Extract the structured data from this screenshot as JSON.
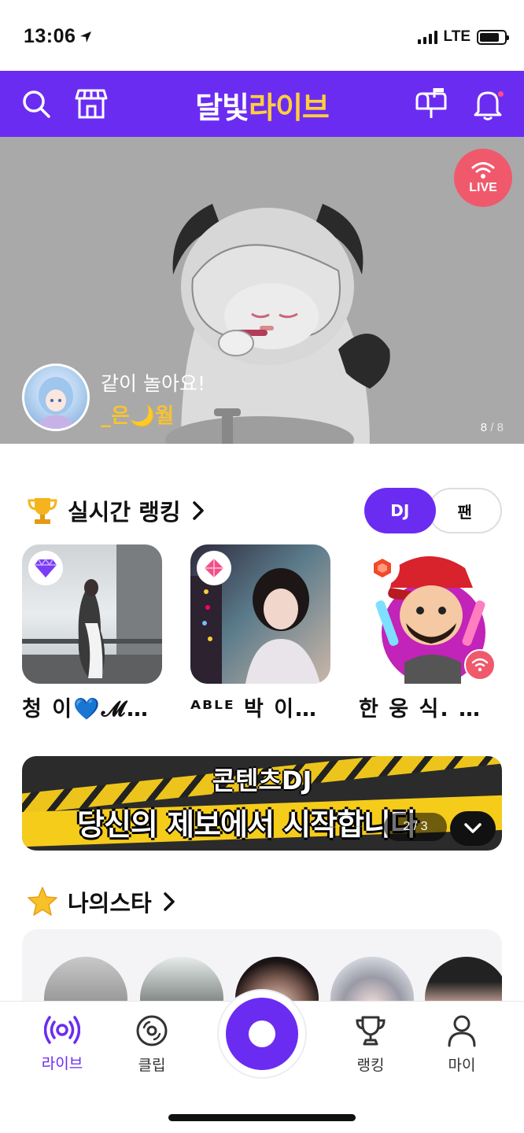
{
  "status_bar": {
    "time": "13:06",
    "network": "LTE",
    "battery_level": 0.8
  },
  "header": {
    "logo_part1": "달빛",
    "logo_part2": "라이브",
    "icons": [
      "search-icon",
      "store-icon",
      "mailbox-icon",
      "bell-icon"
    ],
    "colors": {
      "brand": "#6b2cf2",
      "logo_accent": "#ffcf3a"
    }
  },
  "banner": {
    "live_badge": "LIVE",
    "title": "같이 놀아요!",
    "username": "_은🌙월",
    "counter_current": "8",
    "counter_separator": "/",
    "counter_total": "8"
  },
  "ranking": {
    "title": "실시간 랭킹",
    "tabs": [
      "DJ",
      "팬"
    ],
    "selected_tab": "DJ",
    "items": [
      {
        "name": "청 이💙𝓜…",
        "badge": "diamond-purple-icon",
        "live": false
      },
      {
        "name": "ᴬᴮᴸᴱ 박 이…",
        "badge": "diamond-pink-icon",
        "live": false
      },
      {
        "name": "한 웅 식.  …",
        "badge": "gem-red-icon",
        "live": true
      }
    ]
  },
  "promo": {
    "line1": "콘텐츠DJ",
    "line2": "당신의 제보에서 시작합니다",
    "pager": "2 / 3"
  },
  "my_star": {
    "title": "나의스타",
    "avatar_count": 5
  },
  "bottom_nav": {
    "items": [
      {
        "label": "라이브",
        "icon": "live-radio-icon",
        "active": true
      },
      {
        "label": "클립",
        "icon": "clip-disc-icon",
        "active": false
      },
      {
        "label": "랭킹",
        "icon": "trophy-icon",
        "active": false
      },
      {
        "label": "마이",
        "icon": "person-icon",
        "active": false
      }
    ],
    "center_button": "broadcast-record-icon"
  }
}
